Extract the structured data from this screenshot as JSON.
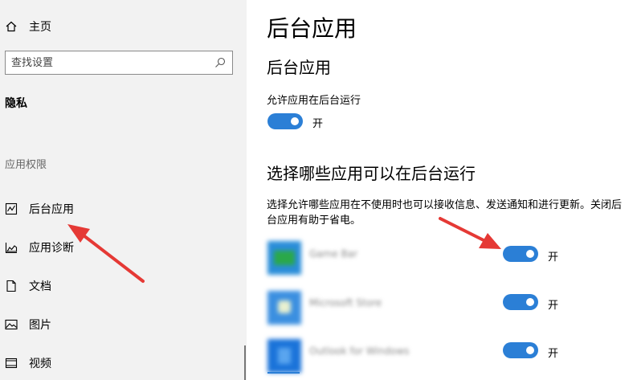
{
  "sidebar": {
    "home": "主页",
    "search_placeholder": "查找设置",
    "section_title": "隐私",
    "category_label": "应用权限",
    "items": [
      {
        "label": "后台应用",
        "icon": "background-apps-icon"
      },
      {
        "label": "应用诊断",
        "icon": "app-diagnostics-icon"
      },
      {
        "label": "文档",
        "icon": "document-icon"
      },
      {
        "label": "图片",
        "icon": "pictures-icon"
      },
      {
        "label": "视频",
        "icon": "video-icon"
      }
    ]
  },
  "main": {
    "page_title": "后台应用",
    "section1_title": "后台应用",
    "allow_label": "允许应用在后台运行",
    "allow_toggle_state": "开",
    "section2_title": "选择哪些应用可以在后台运行",
    "description": "选择允许哪些应用在不使用时也可以接收信息、发送通知和进行更新。关闭后台应用有助于省电。",
    "apps": [
      {
        "name": "Game Bar",
        "state": "开",
        "icon_color": "#2aa84a"
      },
      {
        "name": "Microsoft Store",
        "state": "开",
        "icon_color": "#3b8fe0"
      },
      {
        "name": "Outlook for Windows",
        "state": "开",
        "icon_color": "#1a73d9"
      }
    ]
  },
  "colors": {
    "accent": "#2b7fd6",
    "arrow": "#e53935",
    "sidebar_bg": "#f2f2f2"
  }
}
